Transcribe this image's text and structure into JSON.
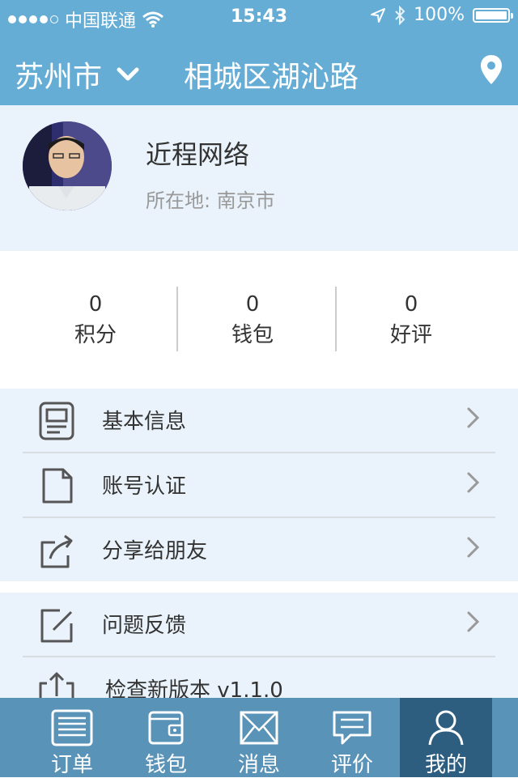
{
  "status_bar": {
    "carrier": "中国联通",
    "time": "15:43",
    "battery": "100%"
  },
  "nav": {
    "city": "苏州市",
    "title": "相城区湖沁路"
  },
  "profile": {
    "name": "近程网络",
    "location": "所在地: 南京市"
  },
  "stats": [
    {
      "value": "0",
      "label": "积分"
    },
    {
      "value": "0",
      "label": "钱包"
    },
    {
      "value": "0",
      "label": "好评"
    }
  ],
  "menu": {
    "basic_info": "基本信息",
    "account_verify": "账号认证",
    "share": "分享给朋友",
    "feedback": "问题反馈",
    "check_version": "检查新版本 v1.1.0"
  },
  "tabs": [
    {
      "label": "订单"
    },
    {
      "label": "钱包"
    },
    {
      "label": "消息"
    },
    {
      "label": "评价"
    },
    {
      "label": "我的"
    }
  ],
  "colors": {
    "header": "#66add6",
    "panel": "#eaf3fb",
    "tabbar": "#5a93b8",
    "tab_active": "#2d5e80"
  }
}
